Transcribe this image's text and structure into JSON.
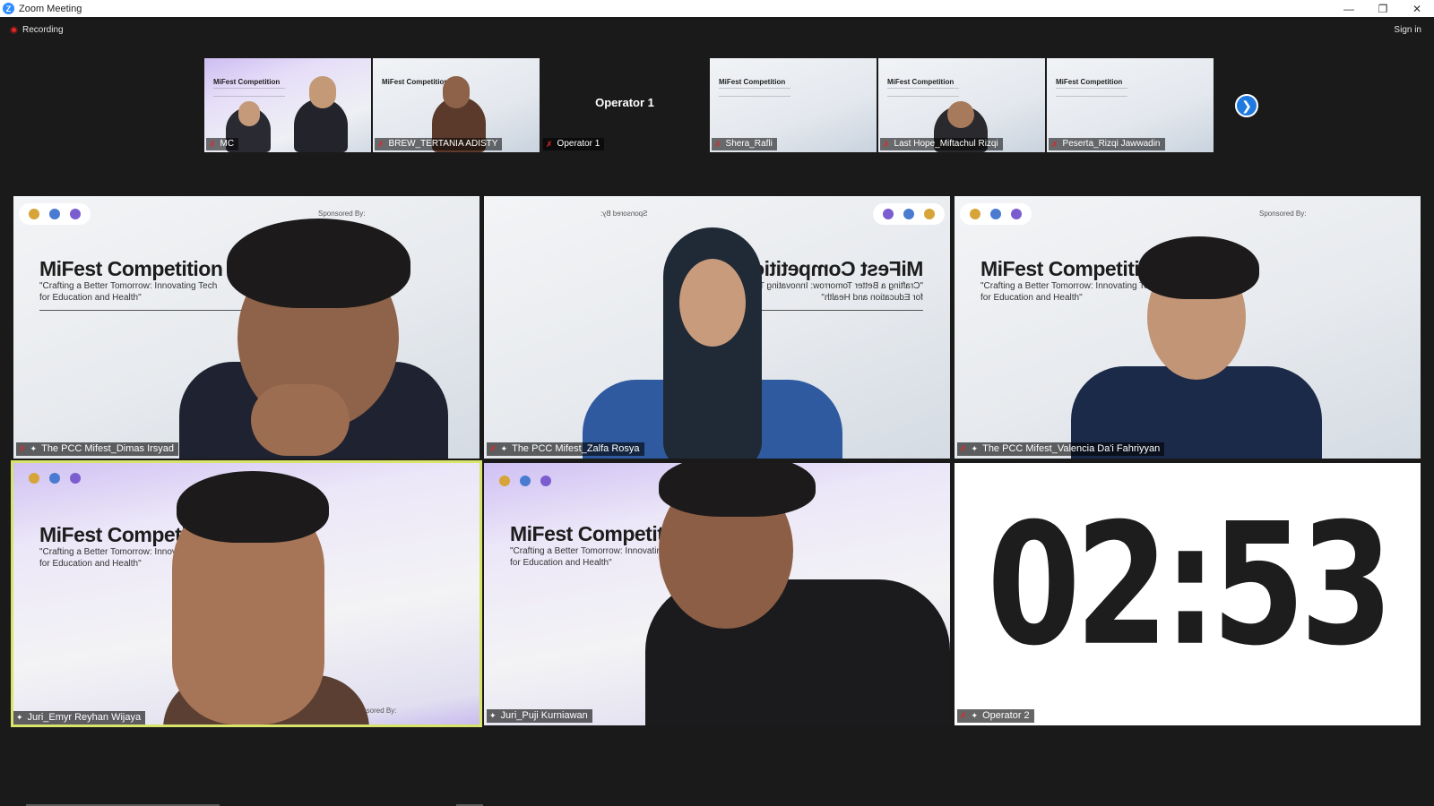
{
  "window": {
    "title": "Zoom Meeting",
    "controls": [
      "minimize",
      "restore",
      "close"
    ]
  },
  "topbar": {
    "recording_label": "Recording",
    "signin_label": "Sign in"
  },
  "strip": [
    {
      "name": "MC",
      "muted": true,
      "kind": "video"
    },
    {
      "name": "BREW_TERTANIA ADISTY",
      "muted": true,
      "kind": "video"
    },
    {
      "name": "Operator 1",
      "muted": true,
      "kind": "name-only",
      "center_label": "Operator 1"
    },
    {
      "name": "Shera_Rafli",
      "muted": true,
      "kind": "slide"
    },
    {
      "name": "Last Hope_Miftachul Rizqi",
      "muted": true,
      "kind": "video"
    },
    {
      "name": "Peserta_Rizqi Jawwadin",
      "muted": true,
      "kind": "slide"
    }
  ],
  "slide_text": {
    "title": "MiFest Competition",
    "subtitle": "\"Crafting a Better Tomorrow: Innovating Tech for Education and Health\"",
    "sponsored": "Sponsored By:"
  },
  "gallery": [
    {
      "name": "The PCC Mifest_Dimas Irsyad",
      "muted": true,
      "pinned": true
    },
    {
      "name": "The PCC Mifest_Zalfa Rosya",
      "muted": true,
      "pinned": true
    },
    {
      "name": "The PCC Mifest_Valencia Da'i Fahriyyan",
      "muted": true,
      "pinned": true
    },
    {
      "name": "Juri_Emyr Reyhan Wijaya",
      "muted": false,
      "pinned": true,
      "active_speaker": true
    },
    {
      "name": "Juri_Puji Kurniawan",
      "muted": false,
      "pinned": true
    },
    {
      "name": "Operator 2",
      "muted": true,
      "pinned": true,
      "timer": "02:53"
    }
  ],
  "colors": {
    "accent": "#2d8cff",
    "active_speaker": "#d8e36a",
    "mic_off": "#e02828",
    "background": "#1a1a1a"
  }
}
